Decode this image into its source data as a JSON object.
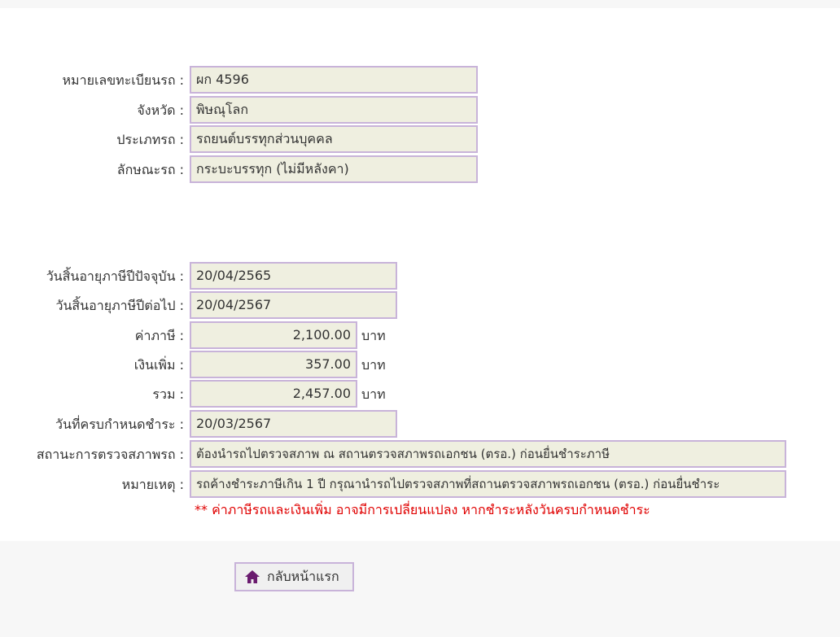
{
  "vehicle": {
    "plate": {
      "label": "หมายเลขทะเบียนรถ :",
      "value": "ผก 4596"
    },
    "province": {
      "label": "จังหวัด :",
      "value": "พิษณุโลก"
    },
    "type": {
      "label": "ประเภทรถ :",
      "value": "รถยนต์บรรทุกส่วนบุคคล"
    },
    "style": {
      "label": "ลักษณะรถ :",
      "value": "กระบะบรรทุก (ไม่มีหลังคา)"
    }
  },
  "tax": {
    "current_expiry": {
      "label": "วันสิ้นอายุภาษีปีปัจจุบัน :",
      "value": "20/04/2565"
    },
    "next_expiry": {
      "label": "วันสิ้นอายุภาษีปีต่อไป :",
      "value": "20/04/2567"
    },
    "amount": {
      "label": "ค่าภาษี :",
      "value": "2,100.00",
      "unit": "บาท"
    },
    "surcharge": {
      "label": "เงินเพิ่ม :",
      "value": "357.00",
      "unit": "บาท"
    },
    "total": {
      "label": "รวม :",
      "value": "2,457.00",
      "unit": "บาท"
    },
    "due_date": {
      "label": "วันที่ครบกำหนดชำระ :",
      "value": "20/03/2567"
    },
    "inspection_status": {
      "label": "สถานะการตรวจสภาพรถ :",
      "value": "ต้องนำรถไปตรวจสภาพ ณ สถานตรวจสภาพรถเอกชน (ตรอ.) ก่อนยื่นชำระภาษี"
    },
    "remark": {
      "label": "หมายเหตุ :",
      "value": "รถค้างชำระภาษีเกิน 1 ปี กรุณานำรถไปตรวจสภาพที่สถานตรวจสภาพรถเอกชน (ตรอ.) ก่อนยื่นชำระ"
    }
  },
  "warning_text": "** ค่าภาษีรถและเงินเพิ่ม อาจมีการเปลี่ยนแปลง หากชำระหลังวันครบกำหนดชำระ",
  "footer": {
    "home_button_label": "กลับหน้าแรก",
    "home_icon": "home-icon"
  },
  "colors": {
    "field_bg": "#efefe0",
    "field_border": "#c8b3d9",
    "warning": "#e00000",
    "icon": "#6a1b6e"
  }
}
